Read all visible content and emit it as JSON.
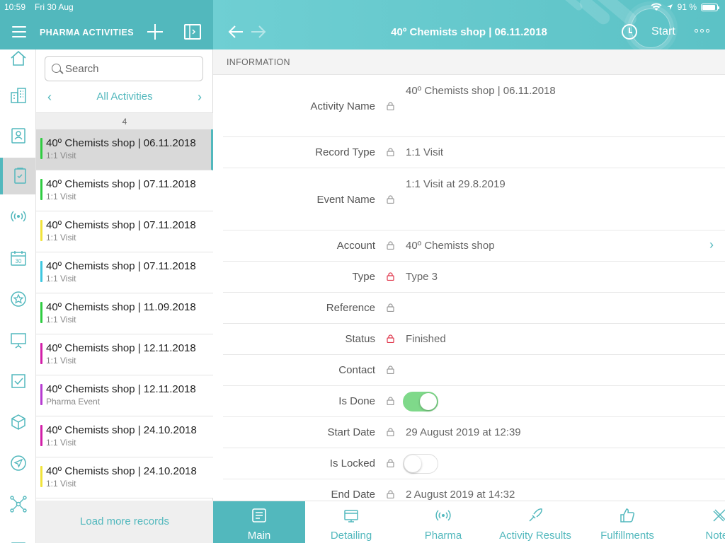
{
  "status_bar": {
    "time": "10:59",
    "date": "Fri 30 Aug",
    "battery": "91 %",
    "battery_level": 0.91
  },
  "left_header": {
    "title": "PHARMA ACTIVITIES"
  },
  "right_header": {
    "title": "40º Chemists shop | 06.11.2018",
    "start_label": "Start"
  },
  "search": {
    "placeholder": "Search"
  },
  "filter": {
    "label": "All Activities"
  },
  "list": {
    "count": "4",
    "load_more": "Load more records",
    "items": [
      {
        "title": "40º Chemists shop | 06.11.2018",
        "subtitle": "1:1 Visit",
        "color": "#2ecc40",
        "selected": true
      },
      {
        "title": "40º Chemists shop | 07.11.2018",
        "subtitle": "1:1 Visit",
        "color": "#2ecc40",
        "selected": false
      },
      {
        "title": "40º Chemists shop | 07.11.2018",
        "subtitle": "1:1 Visit",
        "color": "#f1e33a",
        "selected": false
      },
      {
        "title": "40º Chemists shop | 07.11.2018",
        "subtitle": "1:1 Visit",
        "color": "#3ec7e0",
        "selected": false
      },
      {
        "title": "40º Chemists shop | 11.09.2018",
        "subtitle": "1:1 Visit",
        "color": "#2ecc40",
        "selected": false
      },
      {
        "title": "40º Chemists shop | 12.11.2018",
        "subtitle": "1:1 Visit",
        "color": "#d21fa8",
        "selected": false
      },
      {
        "title": "40º Chemists shop | 12.11.2018",
        "subtitle": "Pharma Event",
        "color": "#b63bd1",
        "selected": false
      },
      {
        "title": "40º Chemists shop | 24.10.2018",
        "subtitle": "1:1 Visit",
        "color": "#d21fa8",
        "selected": false
      },
      {
        "title": "40º Chemists shop | 24.10.2018",
        "subtitle": "1:1 Visit",
        "color": "#f1e33a",
        "selected": false
      }
    ]
  },
  "rail": {
    "icons": [
      "home-icon",
      "building-icon",
      "contacts-icon",
      "activities-icon",
      "broadcast-icon",
      "calendar-icon",
      "star-icon",
      "presentation-icon",
      "checkbox-icon",
      "cube-icon",
      "send-icon",
      "network-icon",
      "more-icon"
    ],
    "calendar_day": "30"
  },
  "detail": {
    "section": "INFORMATION",
    "fields": {
      "activity_name": {
        "label": "Activity Name",
        "value": "40º Chemists shop | 06.11.2018"
      },
      "record_type": {
        "label": "Record Type",
        "value": "1:1 Visit"
      },
      "event_name": {
        "label": "Event Name",
        "value": "1:1 Visit at 29.8.2019"
      },
      "account": {
        "label": "Account",
        "value": "40º Chemists shop"
      },
      "type": {
        "label": "Type",
        "value": "Type 3"
      },
      "reference": {
        "label": "Reference",
        "value": ""
      },
      "status": {
        "label": "Status",
        "value": "Finished"
      },
      "contact": {
        "label": "Contact",
        "value": ""
      },
      "is_done": {
        "label": "Is Done",
        "value": true
      },
      "start_date": {
        "label": "Start Date",
        "value": "29 August 2019 at 12:39"
      },
      "is_locked": {
        "label": "Is Locked",
        "value": false
      },
      "end_date": {
        "label": "End Date",
        "value": "2 August 2019 at 14:32"
      }
    }
  },
  "tabs": [
    {
      "label": "Main",
      "icon": "document-icon",
      "active": true
    },
    {
      "label": "Detailing",
      "icon": "detailing-icon",
      "active": false
    },
    {
      "label": "Pharma",
      "icon": "broadcast-icon",
      "active": false
    },
    {
      "label": "Activity Results",
      "icon": "results-icon",
      "active": false
    },
    {
      "label": "Fulfillments",
      "icon": "thumbs-up-icon",
      "active": false
    },
    {
      "label": "Notes",
      "icon": "notes-icon",
      "active": false
    }
  ],
  "colors": {
    "accent": "#52b8bd",
    "lock_gray": "#999999",
    "lock_red": "#e0364b",
    "toggle_on": "#7fd98a"
  }
}
